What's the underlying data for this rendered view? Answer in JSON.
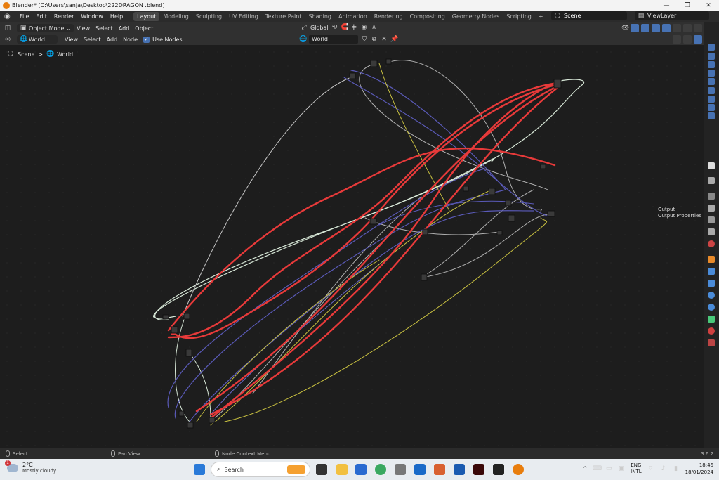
{
  "window": {
    "title": "Blender* [C:\\Users\\sanja\\Desktop\\222DRAGON .blend]",
    "minimize": "—",
    "maximize": "❐",
    "close": "✕"
  },
  "menubar": {
    "menus": [
      "File",
      "Edit",
      "Render",
      "Window",
      "Help"
    ],
    "workspaces": [
      "Layout",
      "Modeling",
      "Sculpting",
      "UV Editing",
      "Texture Paint",
      "Shading",
      "Animation",
      "Rendering",
      "Compositing",
      "Geometry Nodes",
      "Scripting"
    ],
    "active_workspace": "Layout",
    "add_workspace": "+",
    "scene": "Scene",
    "view_layer": "ViewLayer"
  },
  "header1": {
    "mode": "Object Mode",
    "items": [
      "View",
      "Select",
      "Add",
      "Object"
    ],
    "orientation": "Global"
  },
  "header2": {
    "shader_type": "World",
    "items": [
      "View",
      "Select",
      "Add",
      "Node"
    ],
    "use_nodes_label": "Use Nodes",
    "use_nodes_checked": true,
    "world_field": "World",
    "close": "✕"
  },
  "breadcrumb": {
    "items": [
      "Scene",
      "World"
    ],
    "sep": ">"
  },
  "tooltip": {
    "title": "Output",
    "subtitle": "Output Properties"
  },
  "statusbar": {
    "left": "Select",
    "middle": "Pan View",
    "right": "Node Context Menu",
    "version": "3.6.2"
  },
  "taskbar": {
    "weather_temp": "2°C",
    "weather_desc": "Mostly cloudy",
    "weather_badge": "1",
    "search_placeholder": "Search",
    "lang1": "ENG",
    "lang2": "INTL",
    "time": "18:46",
    "date": "18/01/2024",
    "caret": "^"
  },
  "colors": {
    "accent": "#4772b3",
    "wire_red": "#e83a3a",
    "wire_white": "#d8e8d8",
    "wire_yellow": "#c8c040",
    "wire_blue": "#5a5ab8",
    "wire_gray": "#b0b0b0"
  }
}
